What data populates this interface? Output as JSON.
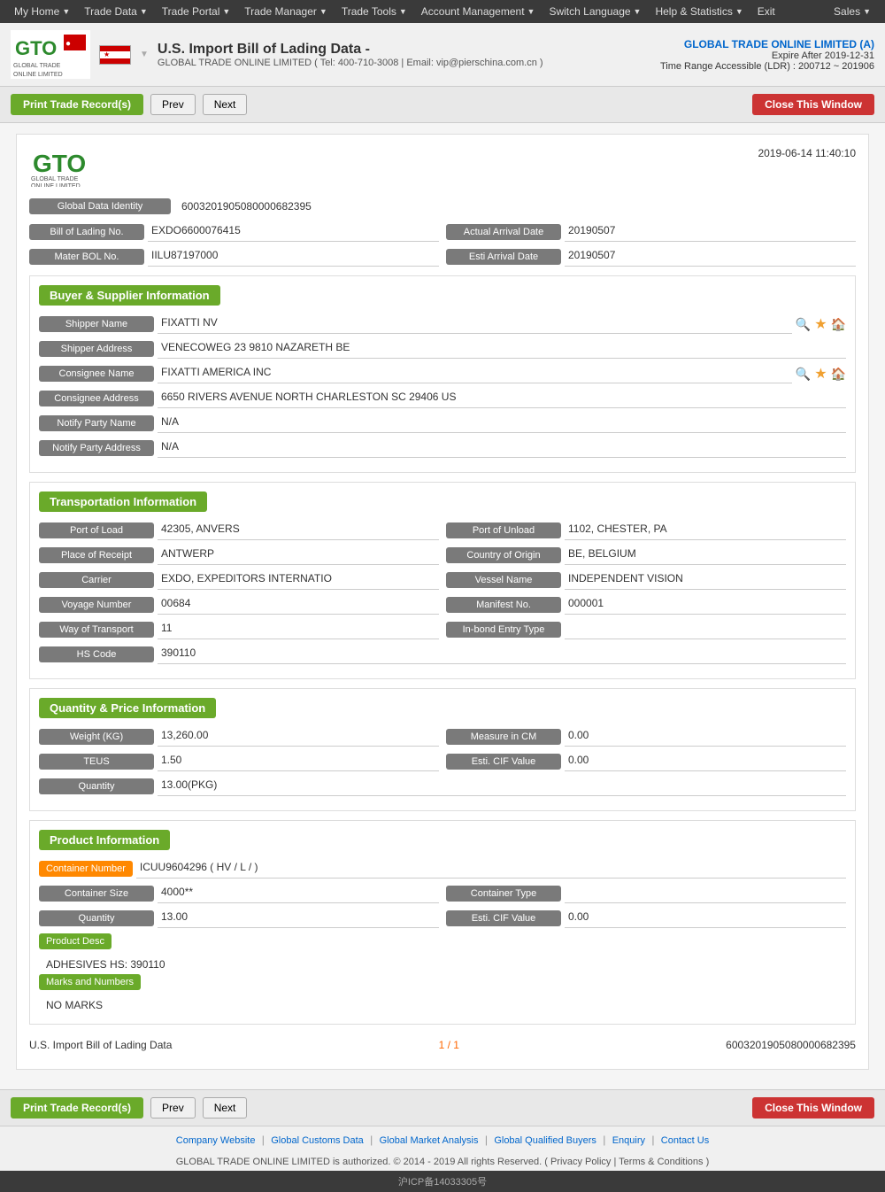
{
  "topnav": {
    "items": [
      "My Home",
      "Trade Data",
      "Trade Portal",
      "Trade Manager",
      "Trade Tools",
      "Account Management",
      "Switch Language",
      "Help & Statistics",
      "Exit"
    ],
    "sales": "Sales"
  },
  "header": {
    "title": "U.S. Import Bill of Lading Data  -",
    "subtitle": "GLOBAL TRADE ONLINE LIMITED  ( Tel: 400-710-3008  |  Email: vip@pierschina.com.cn  )",
    "company": "GLOBAL TRADE ONLINE LIMITED (A)",
    "expire": "Expire After 2019-12-31",
    "ldr": "Time Range Accessible (LDR) : 200712 ~ 201906"
  },
  "toolbar": {
    "print": "Print Trade Record(s)",
    "prev": "Prev",
    "next": "Next",
    "close": "Close This Window"
  },
  "doc": {
    "timestamp": "2019-06-14 11:40:10",
    "global_data_identity_label": "Global Data Identity",
    "global_data_identity_value": "6003201905080000682395",
    "bill_of_lading_label": "Bill of Lading No.",
    "bill_of_lading_value": "EXDO6600076415",
    "actual_arrival_label": "Actual Arrival Date",
    "actual_arrival_value": "20190507",
    "mater_bol_label": "Mater BOL No.",
    "mater_bol_value": "IILU87197000",
    "esti_arrival_label": "Esti Arrival Date",
    "esti_arrival_value": "20190507",
    "buyer_supplier_section": "Buyer & Supplier Information",
    "shipper_name_label": "Shipper Name",
    "shipper_name_value": "FIXATTI NV",
    "shipper_address_label": "Shipper Address",
    "shipper_address_value": "VENECOWEG 23 9810 NAZARETH BE",
    "consignee_name_label": "Consignee Name",
    "consignee_name_value": "FIXATTI AMERICA INC",
    "consignee_address_label": "Consignee Address",
    "consignee_address_value": "6650 RIVERS AVENUE NORTH CHARLESTON SC 29406 US",
    "notify_party_name_label": "Notify Party Name",
    "notify_party_name_value": "N/A",
    "notify_party_address_label": "Notify Party Address",
    "notify_party_address_value": "N/A",
    "transportation_section": "Transportation Information",
    "port_of_load_label": "Port of Load",
    "port_of_load_value": "42305, ANVERS",
    "port_of_unload_label": "Port of Unload",
    "port_of_unload_value": "1102, CHESTER, PA",
    "place_of_receipt_label": "Place of Receipt",
    "place_of_receipt_value": "ANTWERP",
    "country_of_origin_label": "Country of Origin",
    "country_of_origin_value": "BE, BELGIUM",
    "carrier_label": "Carrier",
    "carrier_value": "EXDO, EXPEDITORS INTERNATIO",
    "vessel_name_label": "Vessel Name",
    "vessel_name_value": "INDEPENDENT VISION",
    "voyage_number_label": "Voyage Number",
    "voyage_number_value": "00684",
    "manifest_no_label": "Manifest No.",
    "manifest_no_value": "000001",
    "way_of_transport_label": "Way of Transport",
    "way_of_transport_value": "11",
    "inbond_entry_label": "In-bond Entry Type",
    "inbond_entry_value": "",
    "hs_code_label": "HS Code",
    "hs_code_value": "390110",
    "quantity_section": "Quantity & Price Information",
    "weight_kg_label": "Weight (KG)",
    "weight_kg_value": "13,260.00",
    "measure_in_cm_label": "Measure in CM",
    "measure_in_cm_value": "0.00",
    "teus_label": "TEUS",
    "teus_value": "1.50",
    "esti_cif_label": "Esti. CIF Value",
    "esti_cif_value": "0.00",
    "quantity_label": "Quantity",
    "quantity_value": "13.00(PKG)",
    "product_section": "Product Information",
    "container_number_label": "Container Number",
    "container_number_value": "ICUU9604296 ( HV / L /  )",
    "container_size_label": "Container Size",
    "container_size_value": "4000**",
    "container_type_label": "Container Type",
    "container_type_value": "",
    "quantity2_label": "Quantity",
    "quantity2_value": "13.00",
    "esti_cif2_label": "Esti. CIF Value",
    "esti_cif2_value": "0.00",
    "product_desc_label": "Product Desc",
    "product_desc_value": "ADHESIVES HS: 390110",
    "marks_numbers_label": "Marks and Numbers",
    "marks_numbers_value": "NO MARKS",
    "footer_left": "U.S. Import Bill of Lading Data",
    "footer_page": "1 / 1",
    "footer_id": "6003201905080000682395"
  },
  "footer": {
    "company_website": "Company Website",
    "global_customs_data": "Global Customs Data",
    "global_market_analysis": "Global Market Analysis",
    "global_qualified_buyers": "Global Qualified Buyers",
    "enquiry": "Enquiry",
    "contact_us": "Contact Us",
    "copyright": "GLOBAL TRADE ONLINE LIMITED is authorized. © 2014 - 2019 All rights Reserved.  (  Privacy Policy  |  Terms & Conditions  )",
    "icp": "沪ICP备14033305号"
  }
}
